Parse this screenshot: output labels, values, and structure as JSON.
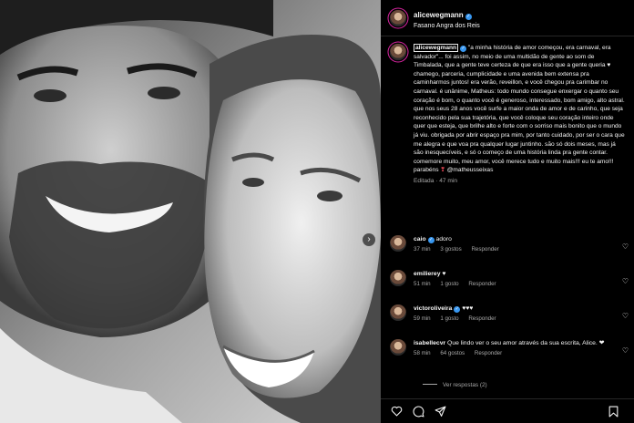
{
  "post": {
    "username": "alicewegmann",
    "location": "Fasano Angra dos Reis",
    "caption": "\"a minha história de amor começou, era carnaval, era salvador\"... foi assim, no meio de uma multidão de gente ao som de Timbalada, que a gente teve certeza de que era isso que a gente queria ♥ chamego, parceria, cumplicidade e uma avenida bem extensa pra caminharmos juntos! era verão, reveillon, e você chegou pra carimbar no carnaval. é unânime, Matheus: todo mundo consegue enxergar o quanto seu coração é bom, o quanto você é generoso, interessado, bom amigo, alto astral. que nos seus 28 anos você surfe a maior onda de amor e de carinho, que seja reconhecido pela sua trajetória, que você coloque seu coração inteiro onde quer que esteja, que brilhe alto e forte com o sorriso mais bonito que o mundo já viu. obrigada por abrir espaço pra mim, por tanto cuidado, por ser o cara que me alegra e que voa pra qualquer lugar juntinho. são só dois meses, mas já são inesquecíveis, e só o começo de uma história linda pra gente contar. comemore muito, meu amor, você merece tudo e muito mais!!! eu te amo!!! parabéns",
    "caption_end_emoji": "❣",
    "mention": "@matheusseixas",
    "edited": "Editada · 47 min"
  },
  "comments": [
    {
      "username": "caio",
      "verified": true,
      "text": "adoro",
      "time": "37 min",
      "likes": "3 gostos",
      "reply": "Responder"
    },
    {
      "username": "emilierey",
      "verified": false,
      "text": "♥",
      "time": "51 min",
      "likes": "1 gosto",
      "reply": "Responder"
    },
    {
      "username": "victoroliveira",
      "verified": true,
      "text": "♥♥♥",
      "time": "59 min",
      "likes": "1 gosto",
      "reply": "Responder"
    },
    {
      "username": "isabellecvr",
      "verified": false,
      "text": "Que lindo ver o seu amor através da sua escrita, Alice. ❤",
      "time": "58 min",
      "likes": "64 gostos",
      "reply": "Responder"
    }
  ],
  "view_replies": "Ver respostas (2)",
  "icons": {
    "like": "heart-icon",
    "comment": "comment-icon",
    "share": "share-icon",
    "save": "bookmark-icon",
    "next": "chevron-right-icon",
    "verified": "verified-badge-icon"
  },
  "colors": {
    "background": "#000000",
    "text": "#f5f5f5",
    "muted": "#a8a8a8",
    "verified": "#3897f0",
    "story_ring": "#d6249f"
  }
}
